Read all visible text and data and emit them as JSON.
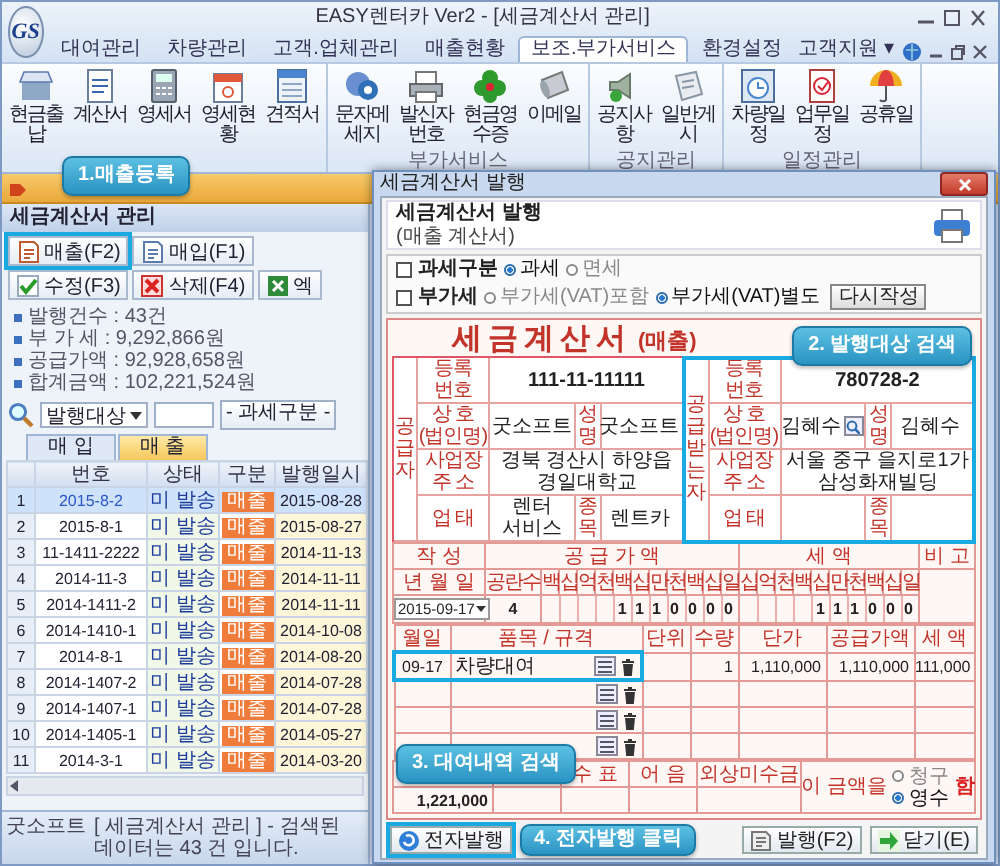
{
  "window": {
    "logo": "GS",
    "title": "EASY렌터카 Ver2 - [세금계산서 관리]"
  },
  "menu": {
    "tabs": [
      {
        "label": "대여관리",
        "selected": false
      },
      {
        "label": "차량관리",
        "selected": false
      },
      {
        "label": "고객.업체관리",
        "selected": false
      },
      {
        "label": "매출현황",
        "selected": false
      },
      {
        "label": "보조.부가서비스",
        "selected": true
      },
      {
        "label": "환경설정",
        "selected": false
      }
    ],
    "support": "고객지원 ▾"
  },
  "ribbon": {
    "groups": [
      {
        "items": [
          "현금출납",
          "계산서",
          "영세서",
          "영세현황",
          "견적서"
        ]
      },
      {
        "label": "부가서비스",
        "items": [
          "문자메세지",
          "발신자번호",
          "현금영수증",
          "이메일"
        ]
      },
      {
        "label": "공지관리",
        "items": [
          "공지사항",
          "일반게시"
        ]
      },
      {
        "label": "일정관리",
        "items": [
          "차량일정",
          "업무일정",
          "공휴일"
        ]
      }
    ]
  },
  "panel": {
    "title": "세금계산서 관리",
    "toolbar": [
      {
        "label": "매출(F2)",
        "highlighted": true
      },
      {
        "label": "매입(F1)",
        "highlighted": false
      },
      {
        "label": "수정(F3)",
        "highlighted": false
      },
      {
        "label": "삭제(F4)",
        "highlighted": false
      },
      {
        "label": "엑",
        "highlighted": false
      }
    ],
    "summary": [
      "발행건수 : 43건",
      "부 가 세 : 9,292,866원",
      "공급가액 : 92,928,658원",
      "합계금액 : 102,221,524원"
    ],
    "search": {
      "field": "발행대상",
      "filter": "- 과세구분 -"
    },
    "subtabs": [
      {
        "label": "매 입",
        "selected": false
      },
      {
        "label": "매 출",
        "selected": true
      }
    ],
    "table": {
      "columns": [
        "번호",
        "상태",
        "구분",
        "발행일시"
      ],
      "rows": [
        {
          "no": "1",
          "number": "2015-8-2",
          "status": "미 발송",
          "type": "매출",
          "date": "2015-08-28",
          "selected": true
        },
        {
          "no": "2",
          "number": "2015-8-1",
          "status": "미 발송",
          "type": "매출",
          "date": "2015-08-27",
          "selected": false
        },
        {
          "no": "3",
          "number": "11-1411-2222",
          "status": "미 발송",
          "type": "매출",
          "date": "2014-11-13",
          "selected": false
        },
        {
          "no": "4",
          "number": "2014-11-3",
          "status": "미 발송",
          "type": "매출",
          "date": "2014-11-11",
          "selected": false
        },
        {
          "no": "5",
          "number": "2014-1411-2",
          "status": "미 발송",
          "type": "매출",
          "date": "2014-11-11",
          "selected": false
        },
        {
          "no": "6",
          "number": "2014-1410-1",
          "status": "미 발송",
          "type": "매출",
          "date": "2014-10-08",
          "selected": false
        },
        {
          "no": "7",
          "number": "2014-8-1",
          "status": "미 발송",
          "type": "매출",
          "date": "2014-08-20",
          "selected": false
        },
        {
          "no": "8",
          "number": "2014-1407-2",
          "status": "미 발송",
          "type": "매출",
          "date": "2014-07-28",
          "selected": false
        },
        {
          "no": "9",
          "number": "2014-1407-1",
          "status": "미 발송",
          "type": "매출",
          "date": "2014-07-28",
          "selected": false
        },
        {
          "no": "10",
          "number": "2014-1405-1",
          "status": "미 발송",
          "type": "매출",
          "date": "2014-05-27",
          "selected": false
        },
        {
          "no": "11",
          "number": "2014-3-1",
          "status": "미 발송",
          "type": "매출",
          "date": "2014-03-20",
          "selected": false
        }
      ]
    },
    "status_bar": {
      "company": "굿소프트",
      "message": "[ 세금계산서 관리 ] - 검색된 데이터는 43 건 입니다."
    }
  },
  "dialog": {
    "title": "세금계산서 발행",
    "heading": "세금계산서 발행",
    "subheading": "(매출 계산서)",
    "tax_type": {
      "label": "과세구분",
      "options": [
        {
          "label": "과세",
          "selected": true
        },
        {
          "label": "면세",
          "selected": false
        }
      ]
    },
    "vat": {
      "label": "부가세",
      "options": [
        {
          "label": "부가세(VAT)포함",
          "selected": false
        },
        {
          "label": "부가세(VAT)별도",
          "selected": true
        }
      ]
    },
    "reset_button": "다시작성",
    "invoice": {
      "title": "세금계산서",
      "title_suffix": "(매출)",
      "supplier": {
        "side_label": "공급자",
        "highlighted": false,
        "fields": [
          {
            "label": "등록 번호",
            "value": "111-11-11111"
          },
          {
            "label": "상 호 (법인명)",
            "value": "굿소프트",
            "lookup": false
          },
          {
            "label": "성명",
            "value": "굿소프트"
          },
          {
            "label": "사업장 주 소",
            "value": "경북 경산시 하양읍 경일대학교"
          },
          {
            "label": "업 태",
            "value": "렌터 서비스"
          },
          {
            "label": "종목",
            "value": "렌트카"
          }
        ]
      },
      "buyer": {
        "side_label": "공급받는자",
        "highlighted": true,
        "fields": [
          {
            "label": "등록 번호",
            "value": "780728-2"
          },
          {
            "label": "상 호 (법인명)",
            "value": "김혜수",
            "lookup": true
          },
          {
            "label": "성명",
            "value": "김혜수"
          },
          {
            "label": "사업장 주 소",
            "value": "서울 중구 을지로1가 삼성화재빌딩"
          },
          {
            "label": "업 태"
          },
          {
            "label": "종목"
          }
        ]
      },
      "summary_headers": [
        "작 성",
        "공 급 가 액",
        "세 액",
        "비 고"
      ],
      "date_label": "년 월 일",
      "blank_label": "공란수",
      "supply_places": [
        "백",
        "십",
        "억",
        "천",
        "백",
        "십",
        "만",
        "천",
        "백",
        "십",
        "일"
      ],
      "tax_places": [
        "십",
        "억",
        "천",
        "백",
        "십",
        "만",
        "천",
        "백",
        "십",
        "일"
      ],
      "date": "2015-09-17",
      "blanks": "4",
      "supply_digits": "1110000",
      "tax_digits": "111000",
      "item_columns": [
        "월일",
        "품목 / 규격",
        "단위",
        "수량",
        "단가",
        "공급가액",
        "세 액"
      ],
      "items": [
        {
          "date": "09-17",
          "name": "차량대여",
          "qty": "1",
          "price": "1,110,000",
          "supply": "1,110,000",
          "tax": "111,000",
          "highlighted": true
        },
        {
          "highlighted": false
        },
        {
          "highlighted": false
        },
        {
          "highlighted": false
        }
      ],
      "total_columns": [
        "수 표",
        "어 음",
        "외상미수금"
      ],
      "total": "1,221,000",
      "receipt": {
        "label": "이 금액을",
        "options": [
          {
            "label": "청구",
            "selected": false
          },
          {
            "label": "영수",
            "selected": true
          }
        ],
        "suffix": "함"
      }
    },
    "e_issue_button": {
      "label": "전자발행",
      "highlighted": true
    },
    "buttons": [
      "발행(F2)",
      "닫기(E)"
    ]
  },
  "callouts": [
    "1.매출등록",
    "2. 발행대상 검색",
    "3. 대여내역 검색",
    "4. 전자발행 클릭"
  ]
}
